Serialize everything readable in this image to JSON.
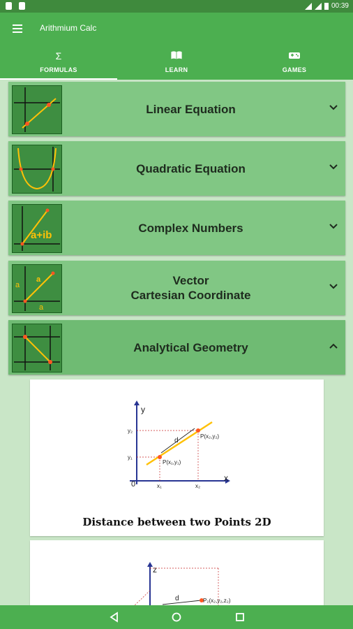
{
  "status": {
    "time": "00:39"
  },
  "app": {
    "title": "Arithmium Calc"
  },
  "tabs": [
    {
      "label": "FORMULAS",
      "icon": "Σ"
    },
    {
      "label": "LEARN"
    },
    {
      "label": "GAMES"
    }
  ],
  "cards": [
    {
      "title": "Linear Equation"
    },
    {
      "title": "Quadratic Equation"
    },
    {
      "title": "Complex Numbers",
      "thumb_text": "a+ib"
    },
    {
      "title_line1": "Vector",
      "title_line2": "Cartesian Coordinate"
    },
    {
      "title": "Analytical Geometry"
    }
  ],
  "panels": [
    {
      "caption": "Distance between two Points 2D",
      "labels": {
        "y": "y",
        "x": "x",
        "origin": "0",
        "y2": "y₂",
        "y1": "y₁",
        "x1": "x₁",
        "x2": "x₂",
        "d": "d",
        "p1": "P(x₁,y₁)",
        "p2": "P(x₂,y₂)"
      }
    },
    {
      "labels": {
        "z": "z",
        "d": "d",
        "p2": "P₂(x₂,y₂,z₂)"
      }
    }
  ],
  "colors": {
    "primary": "#4caf50",
    "dark": "#3f8a3d",
    "card": "#81c784",
    "background": "#c9e6c7",
    "accent_line": "#ffc107",
    "point": "#ff5722"
  }
}
